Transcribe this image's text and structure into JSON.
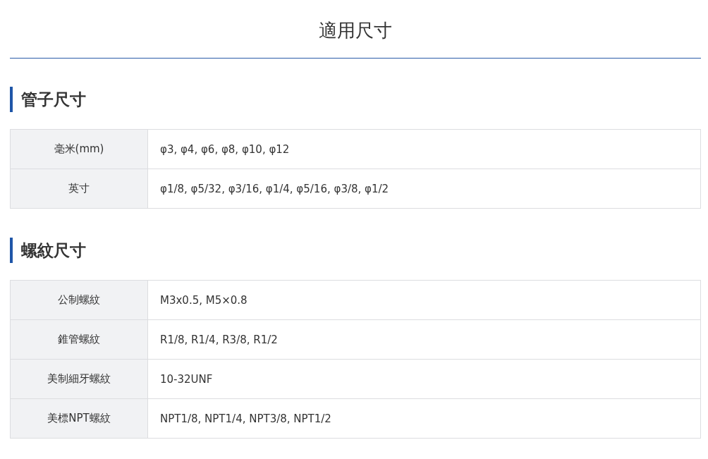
{
  "title": "適用尺寸",
  "sections": [
    {
      "heading": "管子尺寸",
      "rows": [
        {
          "label": "毫米(mm)",
          "value": "φ3, φ4, φ6, φ8, φ10, φ12"
        },
        {
          "label": "英寸",
          "value": "φ1/8, φ5/32, φ3/16, φ1/4, φ5/16, φ3/8, φ1/2"
        }
      ]
    },
    {
      "heading": "螺紋尺寸",
      "rows": [
        {
          "label": "公制螺紋",
          "value": "M3x0.5, M5×0.8"
        },
        {
          "label": "錐管螺紋",
          "value": "R1/8, R1/4, R3/8, R1/2"
        },
        {
          "label": "美制細牙螺紋",
          "value": "10-32UNF"
        },
        {
          "label": "美標NPT螺紋",
          "value": "NPT1/8, NPT1/4, NPT3/8, NPT1/2"
        }
      ]
    }
  ]
}
